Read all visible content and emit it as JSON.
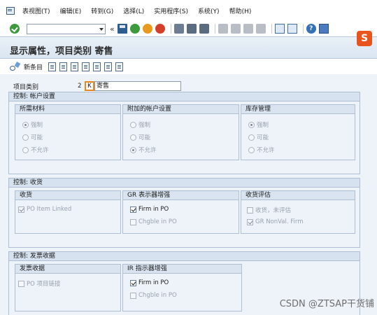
{
  "menu": {
    "items": [
      "表视图(T)",
      "编辑(E)",
      "转到(G)",
      "选择(L)",
      "实用程序(S)",
      "系统(Y)",
      "帮助(H)"
    ]
  },
  "toolbar": {
    "command_field_value": "",
    "chevron": "«",
    "help_glyph": "?"
  },
  "title": "显示属性，项目类别 寄售",
  "app_toolbar": {
    "new_entries_label": "新条目"
  },
  "item_category": {
    "label": "项目类别",
    "code": "2",
    "key": "K",
    "text": "寄售"
  },
  "groups": {
    "account": {
      "title": "控制: 帐户设置",
      "boxes": [
        {
          "header": "所需材料",
          "options": [
            "强制",
            "可能",
            "不允许"
          ],
          "selected": 0
        },
        {
          "header": "附加的帐户设置",
          "options": [
            "强制",
            "可能",
            "不允许"
          ],
          "selected": 2
        },
        {
          "header": "库存管理",
          "options": [
            "强制",
            "可能",
            "不允许"
          ],
          "selected": 0
        }
      ]
    },
    "goods_receipt": {
      "title": "控制: 收货",
      "boxes": [
        {
          "header": "收货",
          "options": [
            {
              "label": "PO Item Linked",
              "checked": true,
              "enabled": false
            }
          ]
        },
        {
          "header": "GR 表示器增强",
          "options": [
            {
              "label": "Firm in PO",
              "checked": true,
              "enabled": true
            },
            {
              "label": "Chgble in PO",
              "checked": false,
              "enabled": false
            }
          ]
        },
        {
          "header": "收货评估",
          "options": [
            {
              "label": "收货，未评估",
              "checked": false,
              "enabled": false
            },
            {
              "label": "GR NonVal. Firm",
              "checked": true,
              "enabled": false
            }
          ]
        }
      ]
    },
    "invoice_receipt": {
      "title": "控制: 发票收据",
      "boxes": [
        {
          "header": "发票收据",
          "options": [
            {
              "label": "PO 项目链接",
              "checked": false,
              "enabled": false
            }
          ]
        },
        {
          "header": "IR 指示器增强",
          "options": [
            {
              "label": "Firm in PO",
              "checked": true,
              "enabled": true
            },
            {
              "label": "Chgble in PO",
              "checked": false,
              "enabled": false
            }
          ]
        }
      ]
    }
  },
  "badge": "S",
  "watermark": "CSDN @ZTSAP干货铺"
}
